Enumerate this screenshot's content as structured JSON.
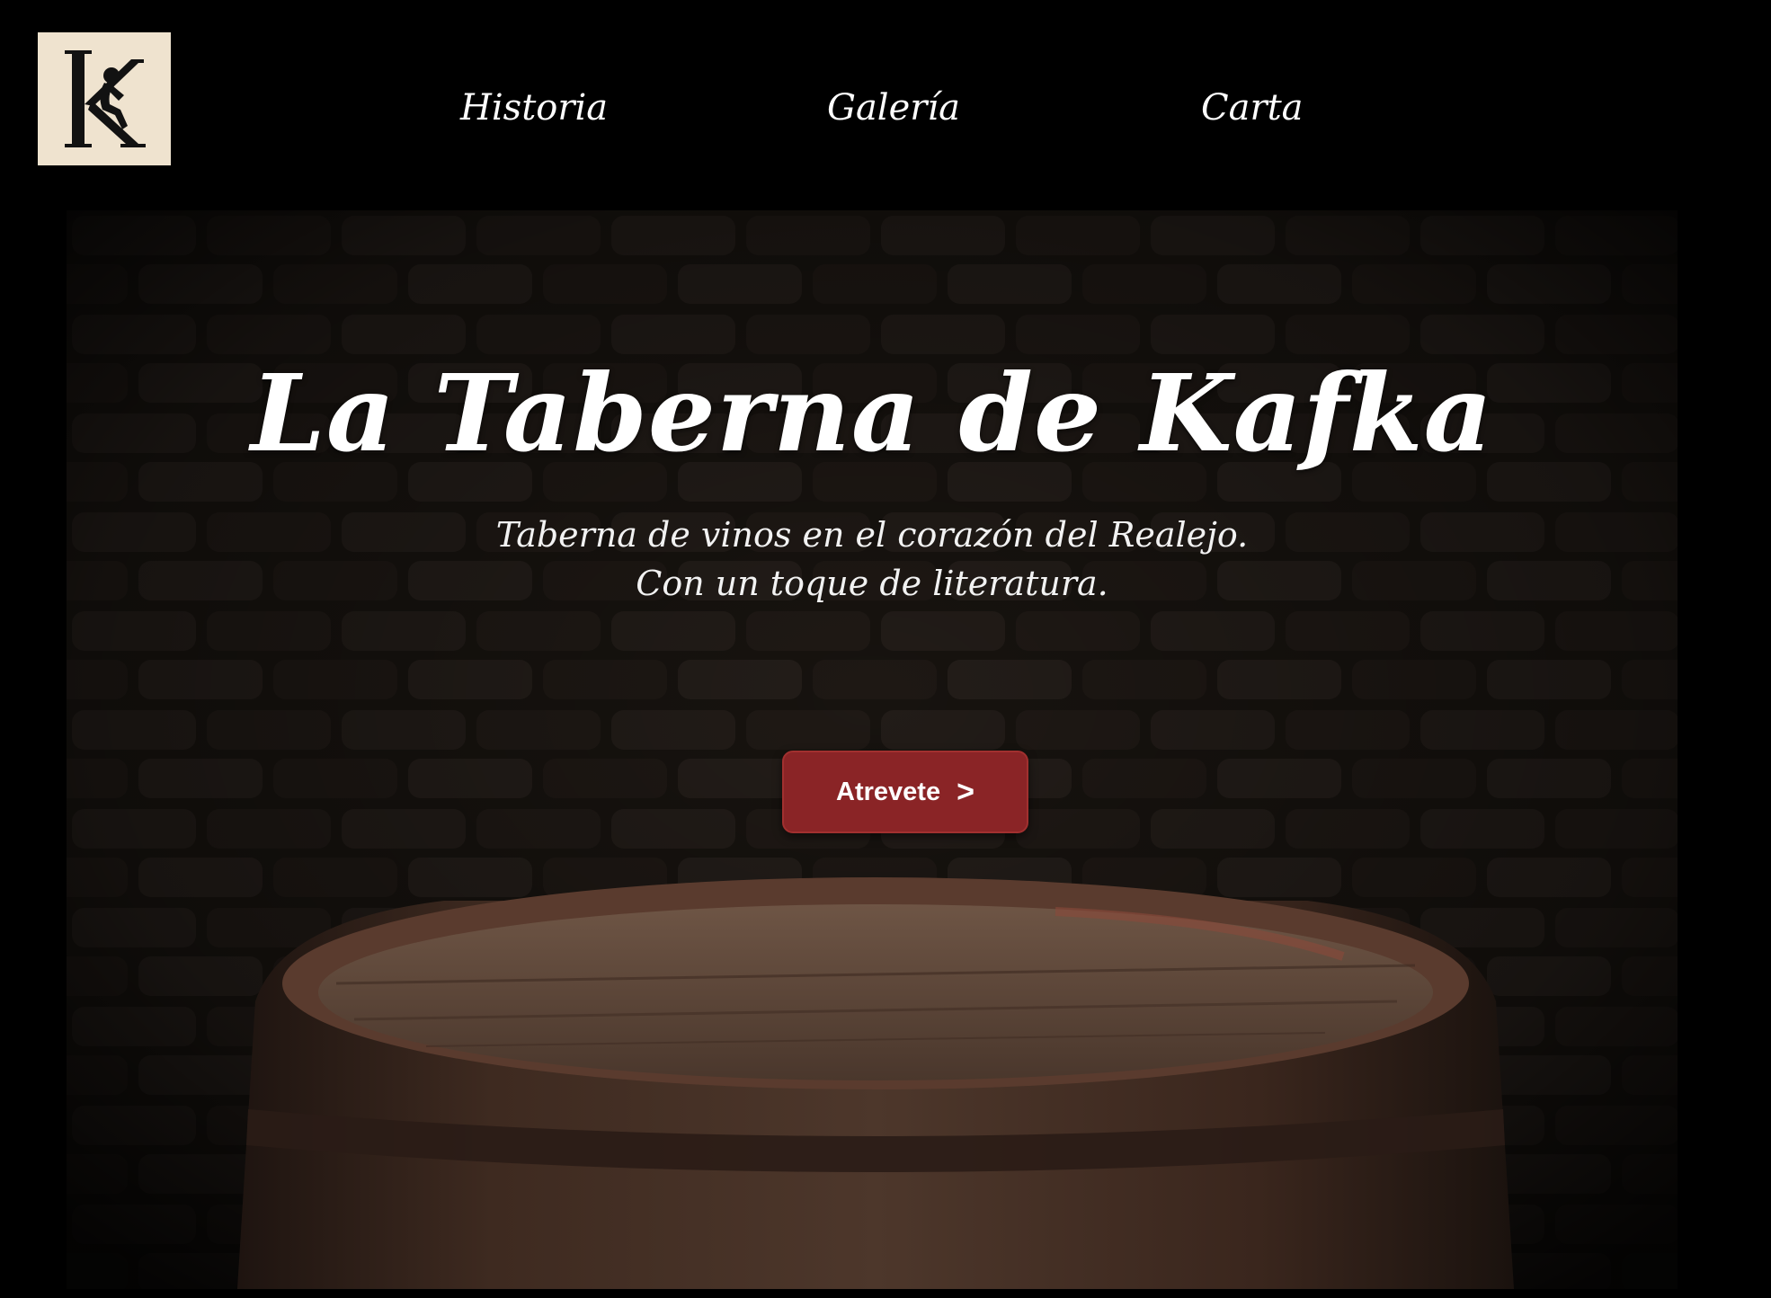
{
  "nav": {
    "items": [
      {
        "label": "Historia"
      },
      {
        "label": "Galería"
      },
      {
        "label": "Carta"
      }
    ]
  },
  "logo": {
    "icon": "kafka-thinker-logo-icon",
    "letter": "K"
  },
  "hero": {
    "title": "La Taberna de Kafka",
    "subtitle_line1": "Taberna de vinos en el corazón del Realejo.",
    "subtitle_line2": "Con un toque de literatura.",
    "cta_label": "Atrevete",
    "cta_icon": ">",
    "background": "brick-wall-wine-barrel-image"
  },
  "colors": {
    "header_bg": "#000000",
    "logo_bg": "#efe3cf",
    "cta_bg": "#8a2426",
    "text": "#ffffff"
  }
}
